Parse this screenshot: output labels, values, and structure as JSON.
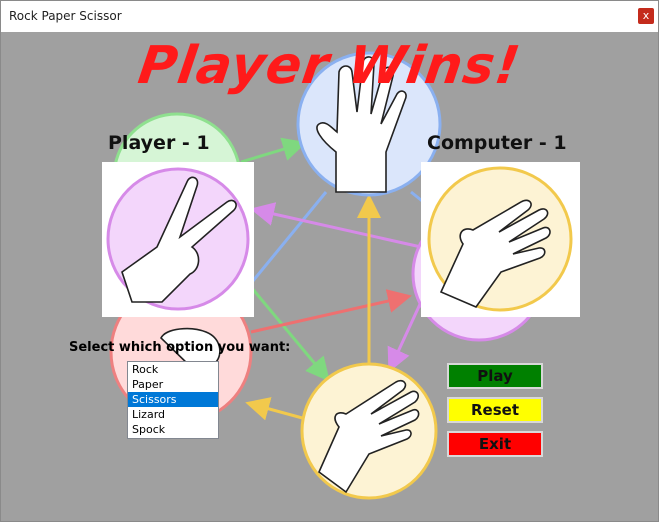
{
  "window": {
    "title": "Rock Paper Scissor",
    "close_label": "x"
  },
  "headline": "Player Wins!",
  "player_score": "Player - 1",
  "computer_score": "Computer - 1",
  "player_choice_icon": "scissors-hand-icon",
  "computer_choice_icon": "paper-hand-icon",
  "prompt": "Select which option you want:",
  "options": [
    {
      "label": "Rock",
      "selected": false
    },
    {
      "label": "Paper",
      "selected": false
    },
    {
      "label": "Scissors",
      "selected": true
    },
    {
      "label": "Lizard",
      "selected": false
    },
    {
      "label": "Spock",
      "selected": false
    }
  ],
  "buttons": {
    "play": {
      "label": "Play",
      "color": "#008000"
    },
    "reset": {
      "label": "Reset",
      "color": "#ffff00"
    },
    "exit": {
      "label": "Exit",
      "color": "#ff0000"
    }
  },
  "colors": {
    "headline": "#ff1a1a",
    "background": "#a0a0a0"
  }
}
